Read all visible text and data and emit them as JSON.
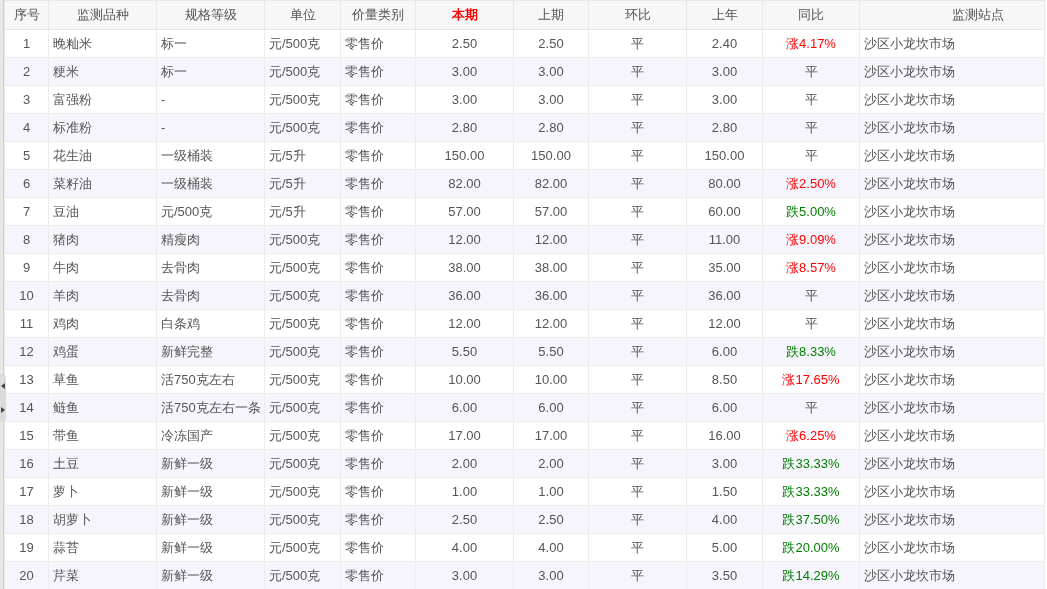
{
  "columns": [
    {
      "label": "序号",
      "highlight": false
    },
    {
      "label": "监测品种",
      "highlight": false
    },
    {
      "label": "规格等级",
      "highlight": false
    },
    {
      "label": "单位",
      "highlight": false
    },
    {
      "label": "价量类别",
      "highlight": false
    },
    {
      "label": "本期",
      "highlight": true
    },
    {
      "label": "上期",
      "highlight": false
    },
    {
      "label": "环比",
      "highlight": false
    },
    {
      "label": "上年",
      "highlight": false
    },
    {
      "label": "同比",
      "highlight": false
    },
    {
      "label": "监测站点",
      "highlight": false
    }
  ],
  "rows": [
    {
      "color": "#ff0000",
      "cells": [
        "1",
        "晚籼米",
        "标一",
        "元/500克",
        "零售价",
        "2.50",
        "2.50",
        "平",
        "2.40",
        "涨4.17%",
        "沙区小龙坎市场"
      ]
    },
    {
      "cells": [
        "2",
        "粳米",
        "标一",
        "元/500克",
        "零售价",
        "3.00",
        "3.00",
        "平",
        "3.00",
        "平",
        "沙区小龙坎市场"
      ]
    },
    {
      "cells": [
        "3",
        "富强粉",
        "-",
        "元/500克",
        "零售价",
        "3.00",
        "3.00",
        "平",
        "3.00",
        "平",
        "沙区小龙坎市场"
      ]
    },
    {
      "cells": [
        "4",
        "标准粉",
        "-",
        "元/500克",
        "零售价",
        "2.80",
        "2.80",
        "平",
        "2.80",
        "平",
        "沙区小龙坎市场"
      ]
    },
    {
      "cells": [
        "5",
        "花生油",
        "一级桶装",
        "元/5升",
        "零售价",
        "150.00",
        "150.00",
        "平",
        "150.00",
        "平",
        "沙区小龙坎市场"
      ]
    },
    {
      "color": "#ff0000",
      "cells": [
        "6",
        "菜籽油",
        "一级桶装",
        "元/5升",
        "零售价",
        "82.00",
        "82.00",
        "平",
        "80.00",
        "涨2.50%",
        "沙区小龙坎市场"
      ]
    },
    {
      "color": "#008000",
      "cells": [
        "7",
        "豆油",
        "元/500克",
        "元/5升",
        "零售价",
        "57.00",
        "57.00",
        "平",
        "60.00",
        "跌5.00%",
        "沙区小龙坎市场"
      ]
    },
    {
      "color": "#ff0000",
      "cells": [
        "8",
        "猪肉",
        "精瘦肉",
        "元/500克",
        "零售价",
        "12.00",
        "12.00",
        "平",
        "11.00",
        "涨9.09%",
        "沙区小龙坎市场"
      ]
    },
    {
      "color": "#ff0000",
      "cells": [
        "9",
        "牛肉",
        "去骨肉",
        "元/500克",
        "零售价",
        "38.00",
        "38.00",
        "平",
        "35.00",
        "涨8.57%",
        "沙区小龙坎市场"
      ]
    },
    {
      "cells": [
        "10",
        "羊肉",
        "去骨肉",
        "元/500克",
        "零售价",
        "36.00",
        "36.00",
        "平",
        "36.00",
        "平",
        "沙区小龙坎市场"
      ]
    },
    {
      "cells": [
        "11",
        "鸡肉",
        "白条鸡",
        "元/500克",
        "零售价",
        "12.00",
        "12.00",
        "平",
        "12.00",
        "平",
        "沙区小龙坎市场"
      ]
    },
    {
      "color": "#008000",
      "cells": [
        "12",
        "鸡蛋",
        "新鲜完整",
        "元/500克",
        "零售价",
        "5.50",
        "5.50",
        "平",
        "6.00",
        "跌8.33%",
        "沙区小龙坎市场"
      ]
    },
    {
      "color": "#ff0000",
      "cells": [
        "13",
        "草鱼",
        "活750克左右",
        "元/500克",
        "零售价",
        "10.00",
        "10.00",
        "平",
        "8.50",
        "涨17.65%",
        "沙区小龙坎市场"
      ]
    },
    {
      "cells": [
        "14",
        "鲢鱼",
        "活750克左右一条",
        "元/500克",
        "零售价",
        "6.00",
        "6.00",
        "平",
        "6.00",
        "平",
        "沙区小龙坎市场"
      ]
    },
    {
      "color": "#ff0000",
      "cells": [
        "15",
        "带鱼",
        "冷冻国产",
        "元/500克",
        "零售价",
        "17.00",
        "17.00",
        "平",
        "16.00",
        "涨6.25%",
        "沙区小龙坎市场"
      ]
    },
    {
      "color": "#008000",
      "cells": [
        "16",
        "土豆",
        "新鲜一级",
        "元/500克",
        "零售价",
        "2.00",
        "2.00",
        "平",
        "3.00",
        "跌33.33%",
        "沙区小龙坎市场"
      ]
    },
    {
      "color": "#008000",
      "cells": [
        "17",
        "萝卜",
        "新鲜一级",
        "元/500克",
        "零售价",
        "1.00",
        "1.00",
        "平",
        "1.50",
        "跌33.33%",
        "沙区小龙坎市场"
      ]
    },
    {
      "color": "#008000",
      "cells": [
        "18",
        "胡萝卜",
        "新鲜一级",
        "元/500克",
        "零售价",
        "2.50",
        "2.50",
        "平",
        "4.00",
        "跌37.50%",
        "沙区小龙坎市场"
      ]
    },
    {
      "color": "#008000",
      "cells": [
        "19",
        "蒜苔",
        "新鲜一级",
        "元/500克",
        "零售价",
        "4.00",
        "4.00",
        "平",
        "5.00",
        "跌20.00%",
        "沙区小龙坎市场"
      ]
    },
    {
      "color": "#008000",
      "cells": [
        "20",
        "芹菜",
        "新鲜一级",
        "元/500克",
        "零售价",
        "3.00",
        "3.00",
        "平",
        "3.50",
        "跌14.29%",
        "沙区小龙坎市场"
      ]
    }
  ]
}
